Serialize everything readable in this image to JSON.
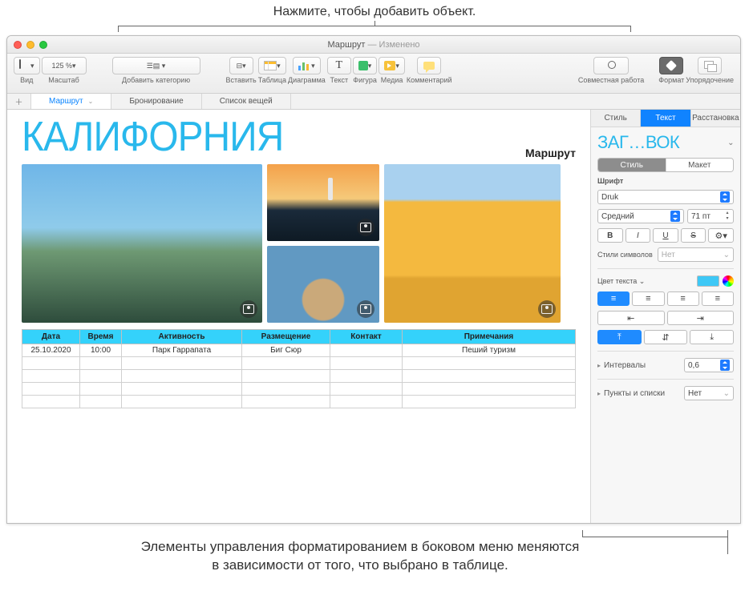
{
  "callouts": {
    "top": "Нажмите, чтобы добавить объект.",
    "bottom": "Элементы управления форматированием в боковом меню меняются в зависимости от того, что выбрано в таблице."
  },
  "window": {
    "title": "Маршрут",
    "modified": "— Изменено"
  },
  "toolbar": {
    "view": "Вид",
    "zoom_value": "125 %",
    "zoom_label": "Масштаб",
    "add_category": "Добавить категорию",
    "insert": "Вставить",
    "table": "Таблица",
    "chart": "Диаграмма",
    "text": "Текст",
    "shape": "Фигура",
    "media": "Медиа",
    "comment": "Комментарий",
    "collab": "Совместная работа",
    "format": "Формат",
    "arrange": "Упорядочение"
  },
  "sheet_tabs": [
    "Маршрут",
    "Бронирование",
    "Список вещей"
  ],
  "document": {
    "title": "КАЛИФОРНИЯ",
    "subtitle": "Маршрут"
  },
  "table": {
    "headers": [
      "Дата",
      "Время",
      "Активность",
      "Размещение",
      "Контакт",
      "Примечания"
    ],
    "rows": [
      [
        "25.10.2020",
        "10:00",
        "Парк Гаррапата",
        "Биг Сюр",
        "",
        "Пеший туризм"
      ],
      [
        "",
        "",
        "",
        "",
        "",
        ""
      ],
      [
        "",
        "",
        "",
        "",
        "",
        ""
      ],
      [
        "",
        "",
        "",
        "",
        "",
        ""
      ],
      [
        "",
        "",
        "",
        "",
        "",
        ""
      ]
    ]
  },
  "inspector": {
    "tabs": {
      "style": "Стиль",
      "text": "Текст",
      "arrange": "Расстановка"
    },
    "paragraph_style": "ЗАГ…ВОК",
    "subtabs": {
      "style": "Стиль",
      "layout": "Макет"
    },
    "font_label": "Шрифт",
    "font_family": "Druk",
    "font_weight": "Средний",
    "font_size": "71 пт",
    "bold": "B",
    "italic": "I",
    "underline": "U",
    "strike": "S",
    "char_styles_label": "Стили символов",
    "char_styles_value": "Нет",
    "text_color_label": "Цвет текста",
    "spacing_label": "Интервалы",
    "spacing_value": "0,6",
    "lists_label": "Пункты и списки",
    "lists_value": "Нет"
  }
}
